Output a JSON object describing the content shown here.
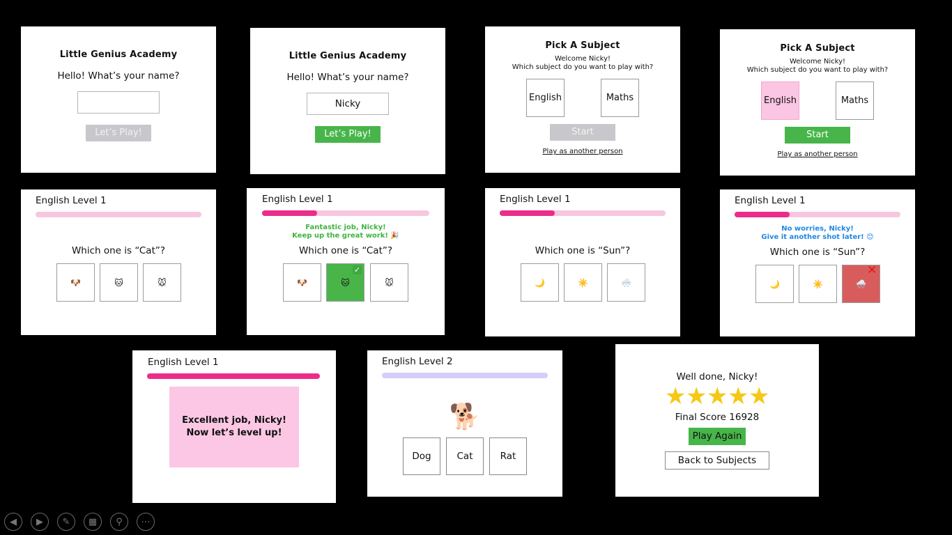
{
  "app_title": "Little Genius Academy",
  "name_prompt": "Hello! What’s your name?",
  "name_input_value": "Nicky",
  "lets_play_label": "Let’s Play!",
  "pick_subject_title": "Pick A Subject",
  "welcome_text": "Welcome Nicky!",
  "subject_question": "Which subject do you want to play with?",
  "subjects": [
    "English",
    "Maths"
  ],
  "start_label": "Start",
  "another_person_link": "Play as another person",
  "english_level1_subject": "English",
  "level1_label": "Level 1",
  "english_level2": "English Level 2",
  "question_cat": "Which one is “Cat”?",
  "question_sun": "Which one is “Sun”?",
  "options_cat": [
    "🐶",
    "🐱",
    "🐭"
  ],
  "options_sun": [
    "🌙",
    "☀️",
    "🌨️"
  ],
  "feedback_correct": {
    "line1": "Fantastic job, Nicky!",
    "line2": "Keep up the great work! 🎉"
  },
  "feedback_wrong": {
    "line1": "No worries, Nicky!",
    "line2": "Give it another shot later! 😊"
  },
  "correct_mark": "✓",
  "wrong_mark": "✕",
  "level_up": {
    "line1": "Excellent job, Nicky!",
    "line2": "Now let’s level up!"
  },
  "level2_picture": "🐕",
  "level2_words": [
    "Dog",
    "Cat",
    "Rat"
  ],
  "final": {
    "greeting": "Well done, Nicky!",
    "stars": 5,
    "score_text": "Final Score 16928",
    "play_again": "Play Again",
    "back_to_subjects": "Back to Subjects"
  },
  "progress": {
    "level1_start": 0,
    "level1_after_q1": 0.33,
    "level1_complete": 1.0,
    "level2_start": 0
  },
  "colors": {
    "green": "#47b54a",
    "pink_accent": "#ec2c8a",
    "pink_light": "#f7c6df",
    "lavender": "#d3cff8",
    "star": "#f6c816",
    "correct_text": "#3fb43f",
    "wrong_text": "#1e88e5",
    "wrong_red": "#d95c5c"
  },
  "slideshow_controls": [
    "previous-icon",
    "next-icon",
    "pen-icon",
    "slides-grid-icon",
    "zoom-icon",
    "more-icon"
  ]
}
